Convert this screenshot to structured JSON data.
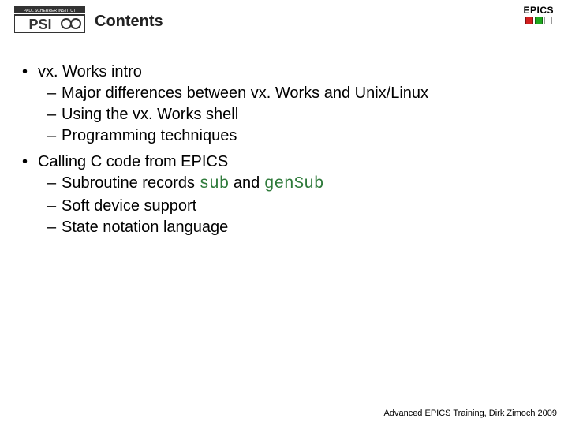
{
  "logo": {
    "psi_top": "PAUL SCHERRER INSTITUT",
    "psi_main": "PSI",
    "epics_label": "EPICS",
    "epics_colors": [
      "#d11f1f",
      "#1fa81f",
      "#ffffff"
    ]
  },
  "title": "Contents",
  "items": [
    {
      "label": "vx. Works intro",
      "children": [
        {
          "label": "Major differences between vx. Works and Unix/Linux"
        },
        {
          "label": "Using the vx. Works shell"
        },
        {
          "label": "Programming techniques"
        }
      ]
    },
    {
      "label": "Calling C code from EPICS",
      "children": [
        {
          "prefix": "Subroutine records ",
          "code1": "sub",
          "mid": " and ",
          "code2": "genSub"
        },
        {
          "label": "Soft device support"
        },
        {
          "label": "State notation language"
        }
      ]
    }
  ],
  "footer": "Advanced EPICS Training, Dirk Zimoch 2009"
}
